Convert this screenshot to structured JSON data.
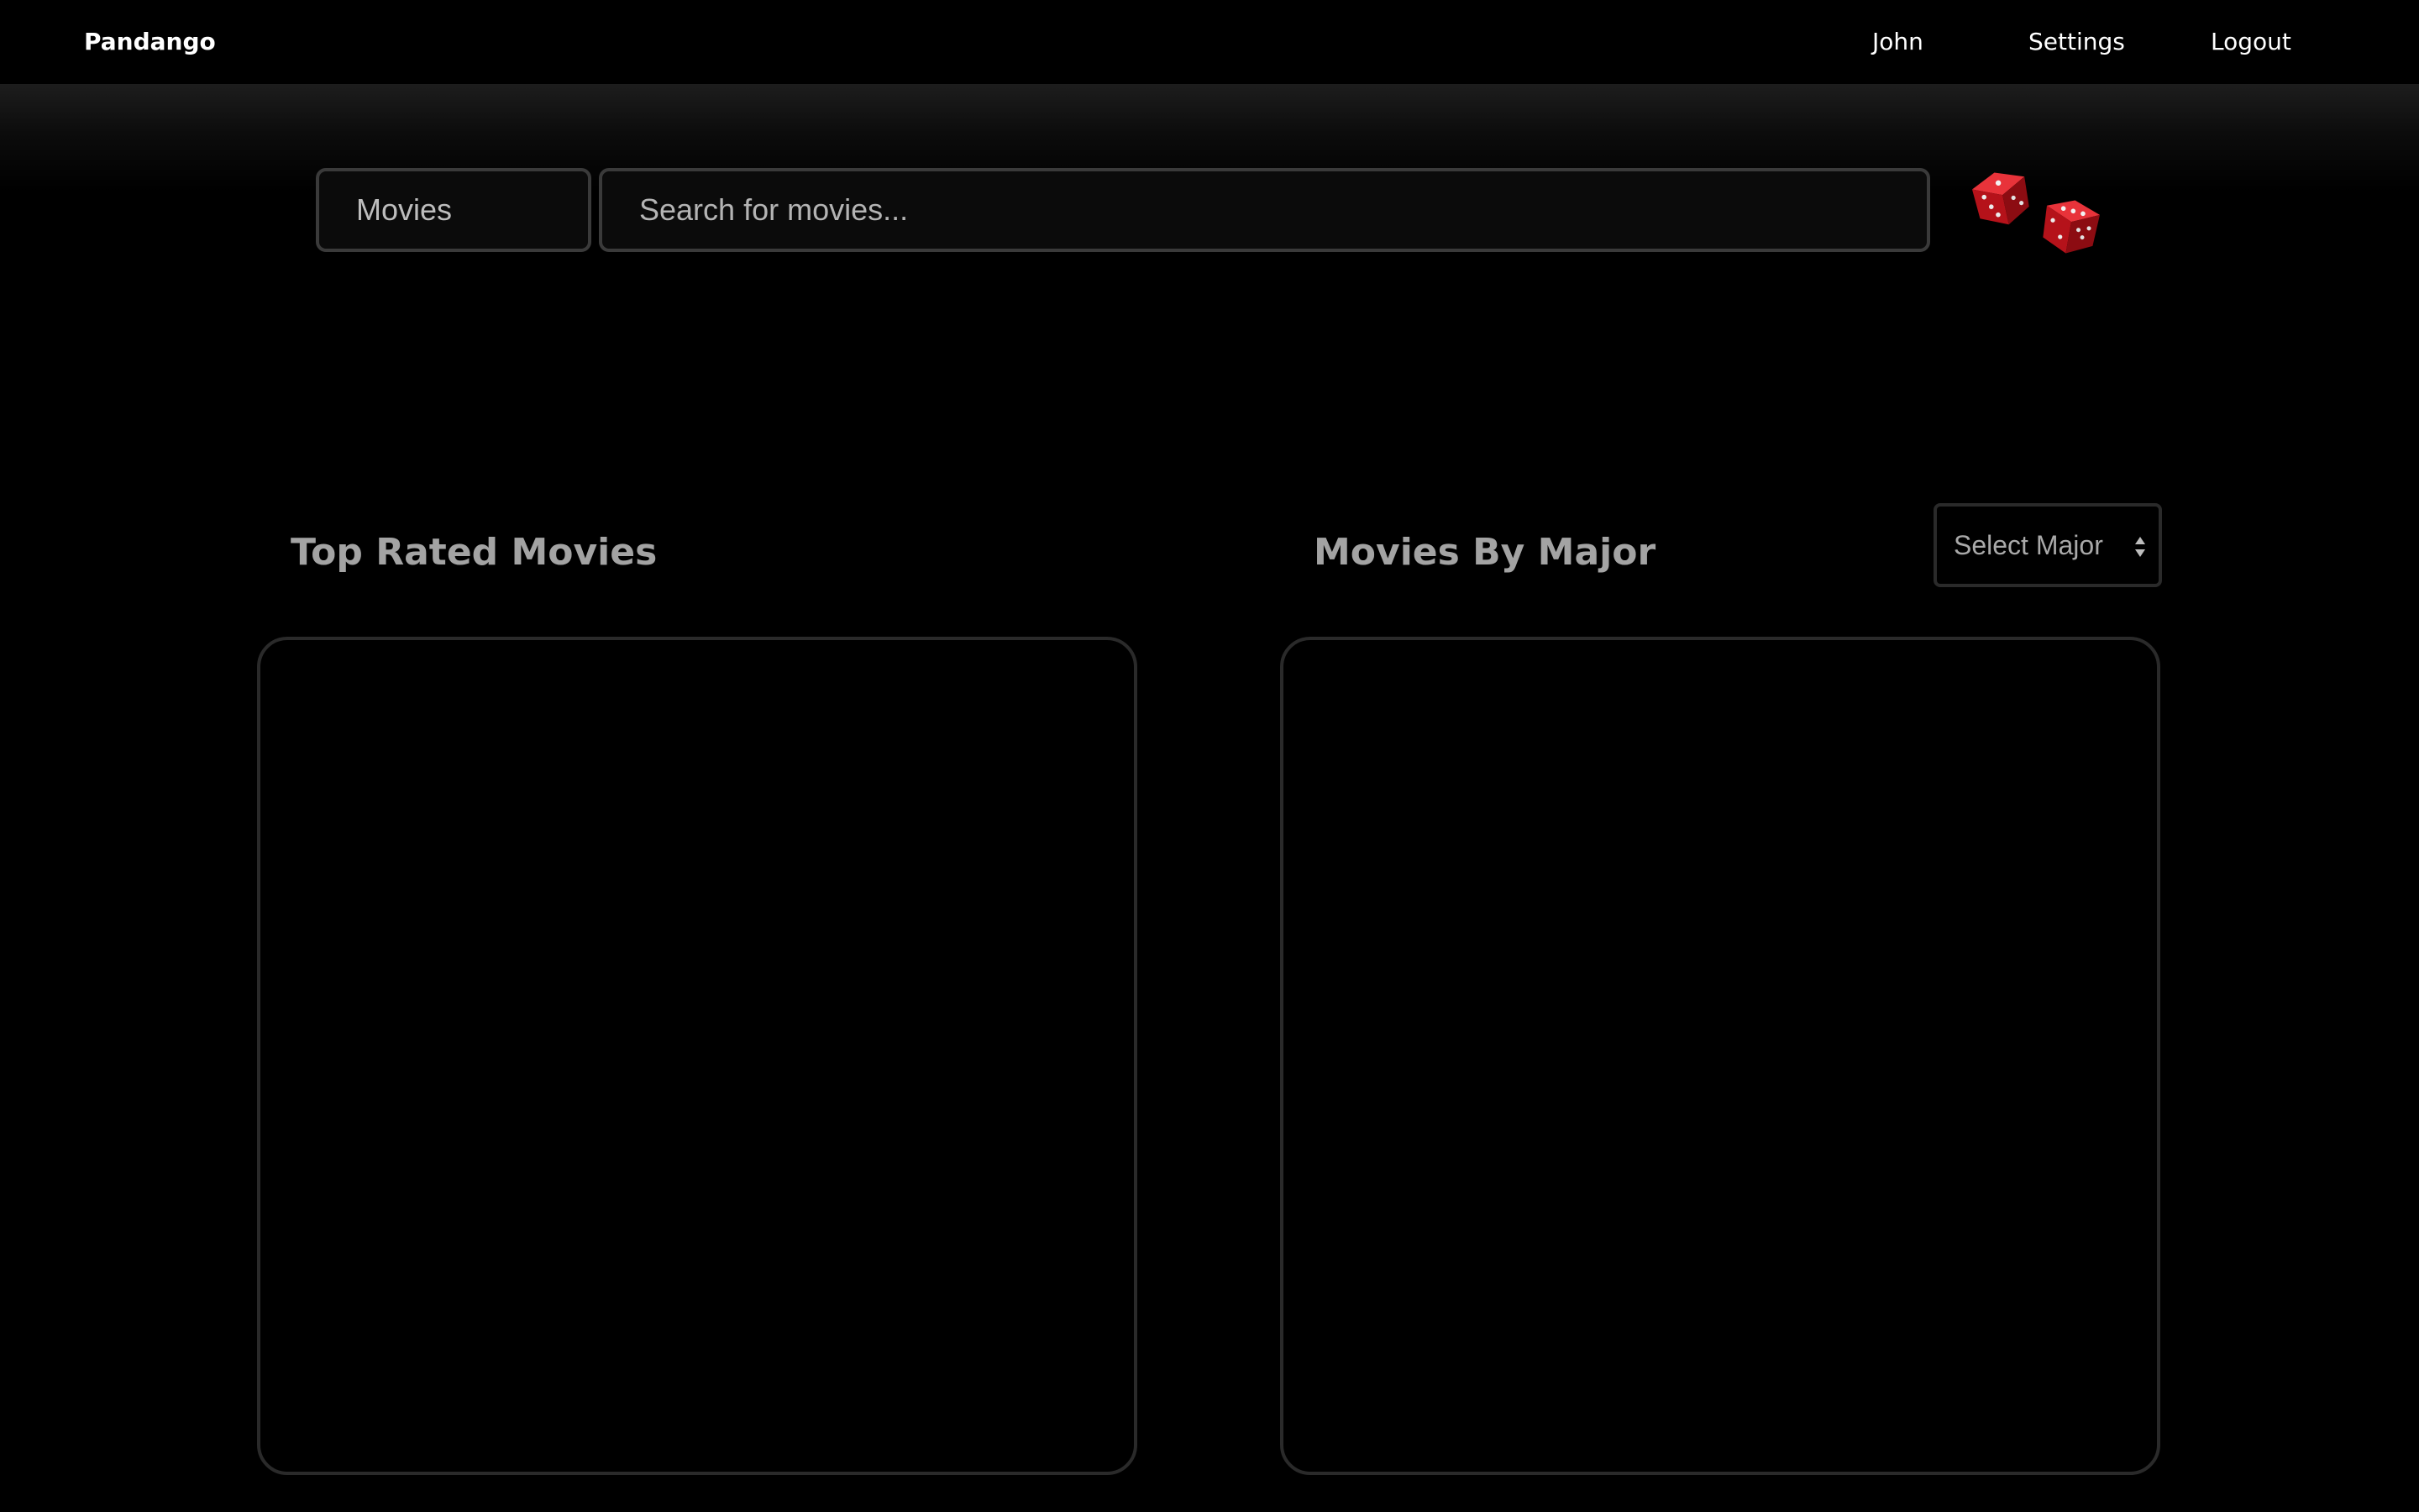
{
  "navbar": {
    "brand": "Pandango",
    "links": [
      "John",
      "Settings",
      "Logout"
    ]
  },
  "search": {
    "category": "Movies",
    "placeholder": "Search for movies..."
  },
  "random_button": {
    "icon": "dice-icon"
  },
  "sections": {
    "top_rated": {
      "title": "Top Rated Movies"
    },
    "by_major": {
      "title": "Movies By Major",
      "select_value": "Select Major"
    }
  },
  "colors": {
    "background": "#000000",
    "nav_text": "#ffffff",
    "section_title": "#a3a3a3",
    "border": "#3a3a3a",
    "dice": "#c8141a"
  }
}
